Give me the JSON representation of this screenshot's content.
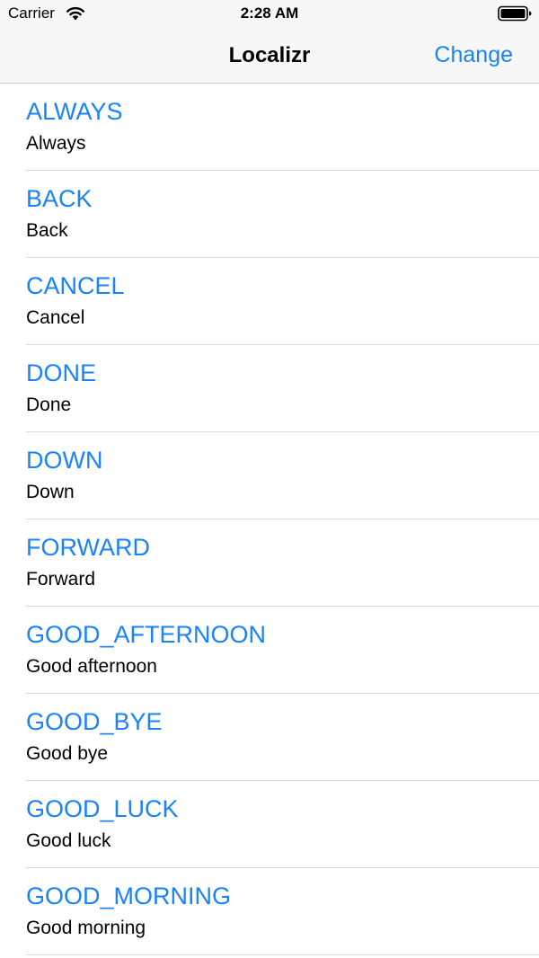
{
  "status_bar": {
    "carrier": "Carrier",
    "time": "2:28 AM",
    "wifi_icon": "wifi-icon",
    "battery_icon": "battery-icon"
  },
  "nav": {
    "title": "Localizr",
    "action_label": "Change"
  },
  "colors": {
    "accent": "#1a82fb",
    "bar_background": "#f7f7f7",
    "separator": "#dcdce0"
  },
  "items": [
    {
      "key": "ALWAYS",
      "value": "Always"
    },
    {
      "key": "BACK",
      "value": "Back"
    },
    {
      "key": "CANCEL",
      "value": "Cancel"
    },
    {
      "key": "DONE",
      "value": "Done"
    },
    {
      "key": "DOWN",
      "value": "Down"
    },
    {
      "key": "FORWARD",
      "value": "Forward"
    },
    {
      "key": "GOOD_AFTERNOON",
      "value": "Good afternoon"
    },
    {
      "key": "GOOD_BYE",
      "value": "Good bye"
    },
    {
      "key": "GOOD_LUCK",
      "value": "Good luck"
    },
    {
      "key": "GOOD_MORNING",
      "value": "Good morning"
    }
  ]
}
